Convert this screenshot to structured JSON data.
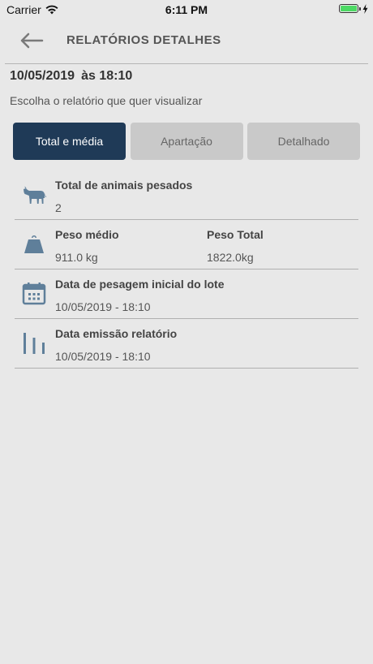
{
  "status_bar": {
    "carrier": "Carrier",
    "time": "6:11 PM",
    "battery_level": 1.0
  },
  "nav": {
    "title": "RELATÓRIOS DETALHES"
  },
  "header": {
    "date": "10/05/2019",
    "time": "às 18:10",
    "subtitle": "Escolha o relatório que quer visualizar"
  },
  "tabs": [
    {
      "label": "Total e média",
      "active": true
    },
    {
      "label": "Apartação",
      "active": false
    },
    {
      "label": "Detalhado",
      "active": false
    }
  ],
  "rows": {
    "total": {
      "label": "Total de animais pesados",
      "value": "2",
      "icon": "cow-icon"
    },
    "peso": {
      "label_medio": "Peso médio",
      "value_medio": "911.0 kg",
      "label_total": "Peso Total",
      "value_total": "1822.0kg",
      "icon": "weight-icon"
    },
    "data_pesagem": {
      "label": "Data de pesagem inicial do lote",
      "value": "10/05/2019  - 18:10",
      "icon": "calendar-icon"
    },
    "data_emissao": {
      "label": "Data emissão relatório",
      "value": "10/05/2019  - 18:10",
      "icon": "bar-chart-icon"
    }
  },
  "colors": {
    "accent": "#1f3a57",
    "icon": "#5f7f9a",
    "background": "#e8e8e8"
  }
}
